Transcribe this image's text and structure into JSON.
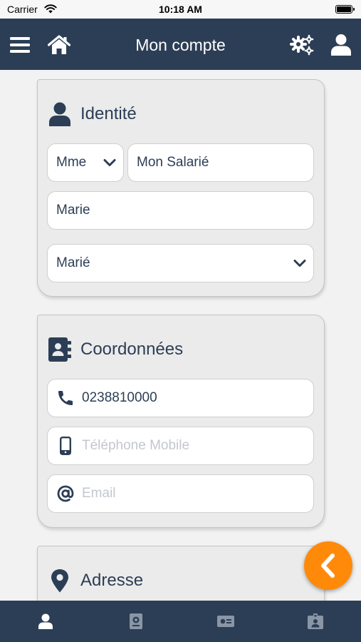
{
  "status_bar": {
    "carrier": "Carrier",
    "time": "10:18 AM"
  },
  "nav": {
    "title": "Mon compte"
  },
  "identity": {
    "title": "Identité",
    "civility": "Mme",
    "last_name": "Mon Salarié",
    "first_name": "Marie",
    "marital_status": "Marié"
  },
  "contact": {
    "title": "Coordonnées",
    "phone": "0238810000",
    "mobile_placeholder": "Téléphone Mobile",
    "email_placeholder": "Email"
  },
  "address": {
    "title": "Adresse"
  },
  "icons": {
    "menu": "hamburger-icon",
    "home": "home-icon",
    "settings": "gears-icon",
    "profile": "user-icon",
    "back": "chevron-left-icon",
    "tabs": [
      "user-icon",
      "passport-icon",
      "money-bill-icon",
      "id-badge-icon"
    ]
  },
  "colors": {
    "primary": "#2c3e55",
    "accent": "#ff8a0a",
    "background": "#f2f2f2",
    "card": "#ebebeb"
  }
}
